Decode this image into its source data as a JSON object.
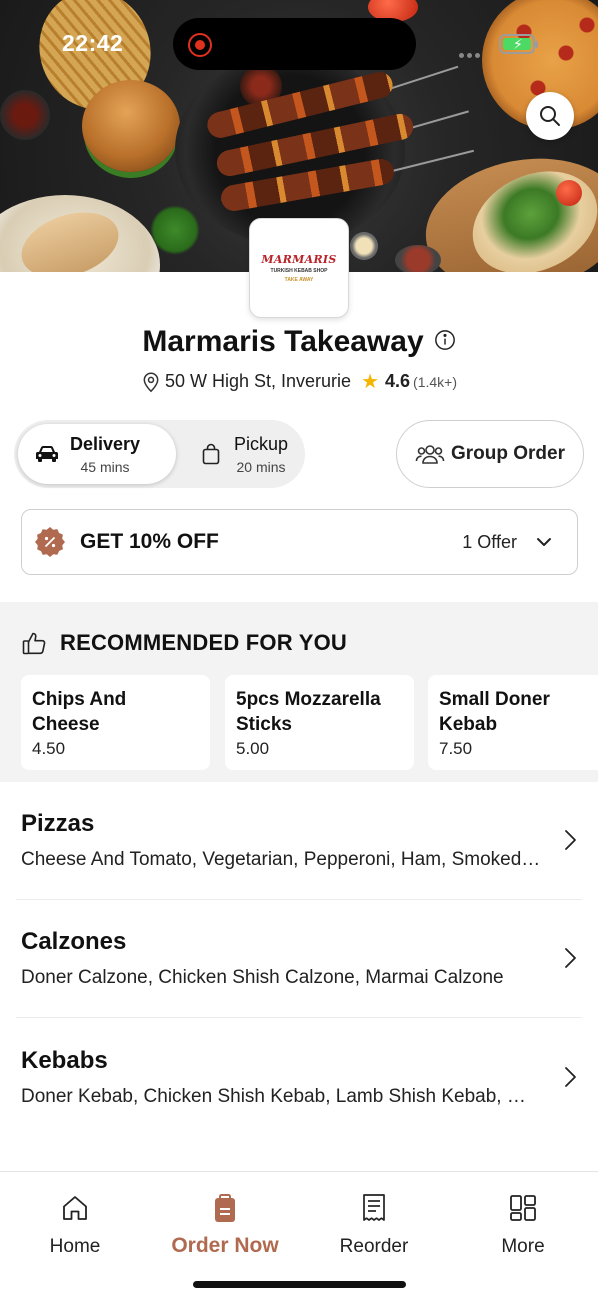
{
  "status_bar": {
    "time": "22:42"
  },
  "restaurant": {
    "logo_text": "MARMARIS",
    "logo_subtitle": "TURKISH KEBAB SHOP",
    "logo_tagline": "TAKE AWAY",
    "name": "Marmaris Takeaway",
    "address": "50 W High St, Inverurie",
    "rating": "4.6",
    "rating_count": "(1.4k+)"
  },
  "order_mode": {
    "options": [
      {
        "label": "Delivery",
        "time": "45 mins",
        "icon": "car-icon",
        "selected": true
      },
      {
        "label": "Pickup",
        "time": "20 mins",
        "icon": "bag-icon",
        "selected": false
      }
    ],
    "group_order_label": "Group Order"
  },
  "offer": {
    "title": "GET 10% OFF",
    "count_label": "1 Offer",
    "icon": "discount-badge-icon"
  },
  "recommended": {
    "heading": "RECOMMENDED FOR YOU",
    "items": [
      {
        "name": "Chips And Cheese",
        "price": "4.50"
      },
      {
        "name": "5pcs Mozzarella Sticks",
        "price": "5.00"
      },
      {
        "name": "Small Doner Kebab",
        "price": "7.50"
      }
    ]
  },
  "categories": [
    {
      "name": "Pizzas",
      "description": "Cheese And Tomato, Vegetarian, Pepperoni, Ham, Smoked Chicken"
    },
    {
      "name": "Calzones",
      "description": "Doner Calzone, Chicken Shish Calzone, Marmai Calzone"
    },
    {
      "name": "Kebabs",
      "description": "Doner Kebab, Chicken Shish Kebab, Lamb Shish Kebab, Mixed Kebab"
    }
  ],
  "bottom_nav": [
    {
      "label": "Home",
      "icon": "home-icon",
      "active": false
    },
    {
      "label": "Order Now",
      "icon": "order-bag-icon",
      "active": true
    },
    {
      "label": "Reorder",
      "icon": "receipt-icon",
      "active": false
    },
    {
      "label": "More",
      "icon": "grid-icon",
      "active": false
    }
  ],
  "colors": {
    "accent": "#b06a50",
    "star": "#f5b400",
    "record": "#e0301e"
  }
}
